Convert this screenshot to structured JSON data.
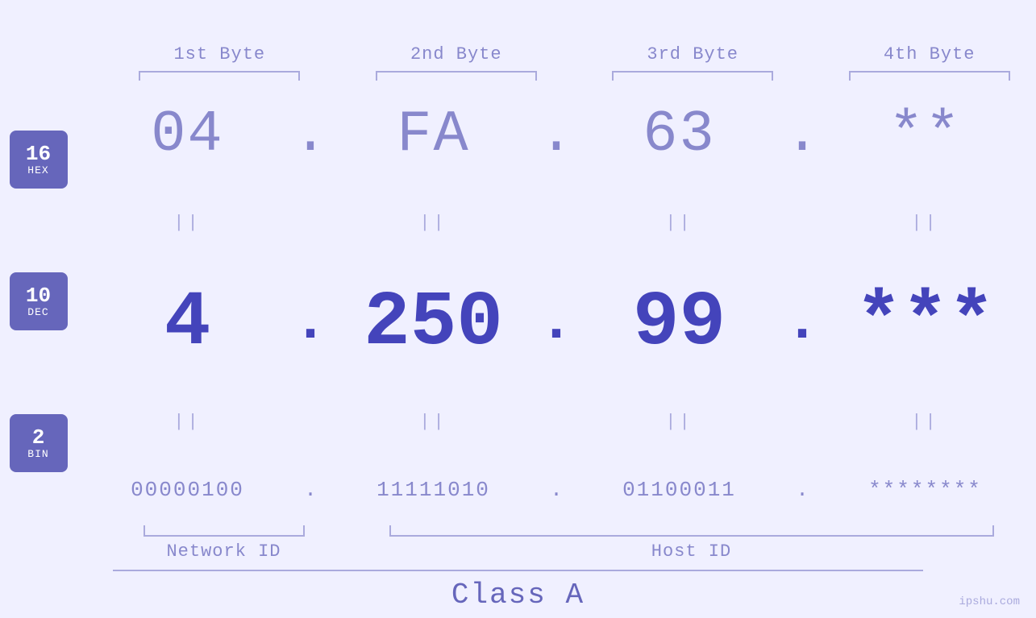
{
  "header": {
    "byte1_label": "1st Byte",
    "byte2_label": "2nd Byte",
    "byte3_label": "3rd Byte",
    "byte4_label": "4th Byte"
  },
  "badges": {
    "hex": {
      "number": "16",
      "label": "HEX"
    },
    "dec": {
      "number": "10",
      "label": "DEC"
    },
    "bin": {
      "number": "2",
      "label": "BIN"
    }
  },
  "rows": {
    "hex": {
      "b1": "04",
      "b2": "FA",
      "b3": "63",
      "b4": "**",
      "dot": "."
    },
    "dec": {
      "b1": "4",
      "b2": "250",
      "b3": "99",
      "b4": "***",
      "dot": "."
    },
    "bin": {
      "b1": "00000100",
      "b2": "11111010",
      "b3": "01100011",
      "b4": "********",
      "dot": "."
    }
  },
  "equals_symbol": "||",
  "labels": {
    "network_id": "Network ID",
    "host_id": "Host ID",
    "class": "Class A"
  },
  "watermark": "ipshu.com"
}
